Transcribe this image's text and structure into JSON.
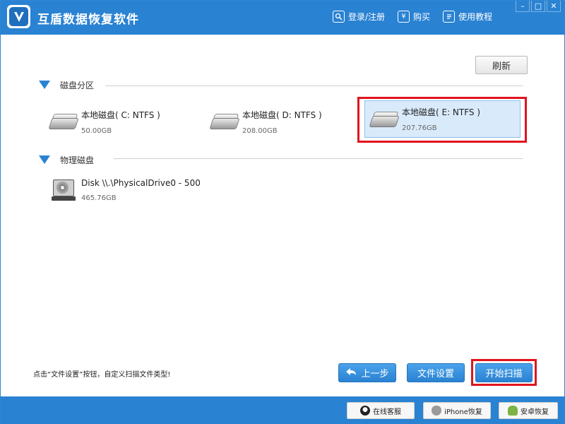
{
  "app": {
    "title": "互盾数据恢复软件"
  },
  "header": {
    "links": [
      {
        "label": "登录/注册",
        "icon": "user-search-icon"
      },
      {
        "label": "购买",
        "icon": "yen-icon"
      },
      {
        "label": "使用教程",
        "icon": "document-icon"
      }
    ],
    "window_controls": [
      "minimize-icon",
      "maximize-icon",
      "close-icon"
    ]
  },
  "toolbar": {
    "refresh_label": "刷新"
  },
  "partitions": {
    "section_label": "磁盘分区",
    "items": [
      {
        "name": "本地磁盘( C: NTFS )",
        "size": "50.00GB"
      },
      {
        "name": "本地磁盘( D: NTFS )",
        "size": "208.00GB"
      },
      {
        "name": "本地磁盘( E: NTFS )",
        "size": "207.76GB",
        "selected": true
      }
    ]
  },
  "physical": {
    "section_label": "物理磁盘",
    "items": [
      {
        "name": "Disk \\\\.\\PhysicalDrive0 - 500",
        "size": "465.76GB"
      }
    ]
  },
  "bottom": {
    "hint": "点击“文件设置”按钮，自定义扫描文件类型!",
    "back_label": "上一步",
    "settings_label": "文件设置",
    "start_label": "开始扫描"
  },
  "footer": {
    "buttons": [
      {
        "label": "在线客服",
        "icon": "qq-icon"
      },
      {
        "label": "iPhone恢复",
        "icon": "apple-icon"
      },
      {
        "label": "安卓恢复",
        "icon": "android-icon"
      }
    ]
  },
  "colors": {
    "accent": "#2a82d2",
    "highlight_frame": "#e0141e",
    "selected_bg": "#d9ebfb"
  }
}
